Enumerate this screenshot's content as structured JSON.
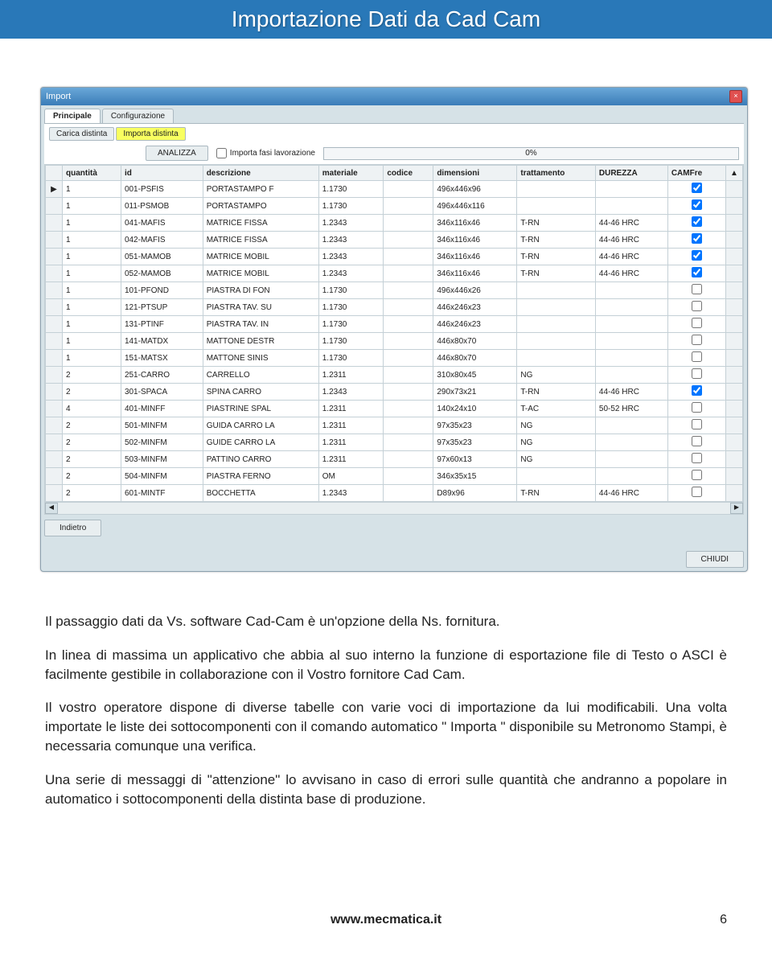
{
  "header_title": "Importazione Dati da Cad Cam",
  "win": {
    "title": "Import",
    "tabs": {
      "principale": "Principale",
      "configurazione": "Configurazione"
    },
    "subtabs": {
      "carica": "Carica distinta",
      "importa": "Importa distinta"
    },
    "analizza": "ANALIZZA",
    "importa_fasi": "Importa fasi lavorazione",
    "progress": "0%",
    "cols": {
      "quantita": "quantità",
      "id": "id",
      "descrizione": "descrizione",
      "materiale": "materiale",
      "codice": "codice",
      "dimensioni": "dimensioni",
      "trattamento": "trattamento",
      "durezza": "DUREZZA",
      "camfre": "CAMFre"
    },
    "rows": [
      {
        "sel": "▶",
        "q": "1",
        "id": "001-PSFIS",
        "desc": "PORTASTAMPO F",
        "mat": "1.1730",
        "cod": "",
        "dim": "496x446x96",
        "tratt": "",
        "dur": "",
        "cam": true
      },
      {
        "sel": "",
        "q": "1",
        "id": "011-PSMOB",
        "desc": "PORTASTAMPO",
        "mat": "1.1730",
        "cod": "",
        "dim": "496x446x116",
        "tratt": "",
        "dur": "",
        "cam": true
      },
      {
        "sel": "",
        "q": "1",
        "id": "041-MAFIS",
        "desc": "MATRICE FISSA",
        "mat": "1.2343",
        "cod": "",
        "dim": "346x116x46",
        "tratt": "T-RN",
        "dur": "44-46 HRC",
        "cam": true
      },
      {
        "sel": "",
        "q": "1",
        "id": "042-MAFIS",
        "desc": "MATRICE FISSA",
        "mat": "1.2343",
        "cod": "",
        "dim": "346x116x46",
        "tratt": "T-RN",
        "dur": "44-46 HRC",
        "cam": true
      },
      {
        "sel": "",
        "q": "1",
        "id": "051-MAMOB",
        "desc": "MATRICE MOBIL",
        "mat": "1.2343",
        "cod": "",
        "dim": "346x116x46",
        "tratt": "T-RN",
        "dur": "44-46 HRC",
        "cam": true
      },
      {
        "sel": "",
        "q": "1",
        "id": "052-MAMOB",
        "desc": "MATRICE MOBIL",
        "mat": "1.2343",
        "cod": "",
        "dim": "346x116x46",
        "tratt": "T-RN",
        "dur": "44-46 HRC",
        "cam": true
      },
      {
        "sel": "",
        "q": "1",
        "id": "101-PFOND",
        "desc": "PIASTRA DI FON",
        "mat": "1.1730",
        "cod": "",
        "dim": "496x446x26",
        "tratt": "",
        "dur": "",
        "cam": false
      },
      {
        "sel": "",
        "q": "1",
        "id": "121-PTSUP",
        "desc": "PIASTRA TAV. SU",
        "mat": "1.1730",
        "cod": "",
        "dim": "446x246x23",
        "tratt": "",
        "dur": "",
        "cam": false
      },
      {
        "sel": "",
        "q": "1",
        "id": "131-PTINF",
        "desc": "PIASTRA TAV. IN",
        "mat": "1.1730",
        "cod": "",
        "dim": "446x246x23",
        "tratt": "",
        "dur": "",
        "cam": false
      },
      {
        "sel": "",
        "q": "1",
        "id": "141-MATDX",
        "desc": "MATTONE DESTR",
        "mat": "1.1730",
        "cod": "",
        "dim": "446x80x70",
        "tratt": "",
        "dur": "",
        "cam": false
      },
      {
        "sel": "",
        "q": "1",
        "id": "151-MATSX",
        "desc": "MATTONE SINIS",
        "mat": "1.1730",
        "cod": "",
        "dim": "446x80x70",
        "tratt": "",
        "dur": "",
        "cam": false
      },
      {
        "sel": "",
        "q": "2",
        "id": "251-CARRO",
        "desc": "CARRELLO",
        "mat": "1.2311",
        "cod": "",
        "dim": "310x80x45",
        "tratt": "NG",
        "dur": "",
        "cam": false
      },
      {
        "sel": "",
        "q": "2",
        "id": "301-SPACA",
        "desc": "SPINA CARRO",
        "mat": "1.2343",
        "cod": "",
        "dim": "290x73x21",
        "tratt": "T-RN",
        "dur": "44-46 HRC",
        "cam": true
      },
      {
        "sel": "",
        "q": "4",
        "id": "401-MINFF",
        "desc": "PIASTRINE SPAL",
        "mat": "1.2311",
        "cod": "",
        "dim": "140x24x10",
        "tratt": "T-AC",
        "dur": "50-52 HRC",
        "cam": false
      },
      {
        "sel": "",
        "q": "2",
        "id": "501-MINFM",
        "desc": "GUIDA CARRO LA",
        "mat": "1.2311",
        "cod": "",
        "dim": "97x35x23",
        "tratt": "NG",
        "dur": "",
        "cam": false
      },
      {
        "sel": "",
        "q": "2",
        "id": "502-MINFM",
        "desc": "GUIDE CARRO LA",
        "mat": "1.2311",
        "cod": "",
        "dim": "97x35x23",
        "tratt": "NG",
        "dur": "",
        "cam": false
      },
      {
        "sel": "",
        "q": "2",
        "id": "503-MINFM",
        "desc": "PATTINO CARRO",
        "mat": "1.2311",
        "cod": "",
        "dim": "97x60x13",
        "tratt": "NG",
        "dur": "",
        "cam": false
      },
      {
        "sel": "",
        "q": "2",
        "id": "504-MINFM",
        "desc": "PIASTRA FERNO",
        "mat": "OM",
        "cod": "",
        "dim": "346x35x15",
        "tratt": "",
        "dur": "",
        "cam": false
      },
      {
        "sel": "",
        "q": "2",
        "id": "601-MINTF",
        "desc": "BOCCHETTA",
        "mat": "1.2343",
        "cod": "",
        "dim": "D89x96",
        "tratt": "T-RN",
        "dur": "44-46 HRC",
        "cam": false
      }
    ],
    "indietro": "Indietro",
    "chiudi": "CHIUDI"
  },
  "paras": {
    "p1": "Il passaggio dati da Vs. software Cad-Cam è un'opzione della Ns. fornitura.",
    "p2": "In linea di massima un applicativo che abbia al suo interno la funzione di esportazione file di Testo o ASCI è facilmente gestibile in collaborazione con il Vostro fornitore Cad Cam.",
    "p3": "Il vostro operatore dispone di diverse tabelle con varie voci di importazione da lui modificabili. Una volta importate le liste dei sottocomponenti con il comando automatico \" Importa \" disponibile su Metronomo Stampi, è necessaria comunque una verifica.",
    "p4": "Una serie di messaggi di \"attenzione\" lo avvisano in caso di errori  sulle quantità che andranno a popolare in automatico i sottocomponenti della distinta base di produzione."
  },
  "footer": {
    "url": "www.mecmatica.it",
    "page": "6"
  }
}
